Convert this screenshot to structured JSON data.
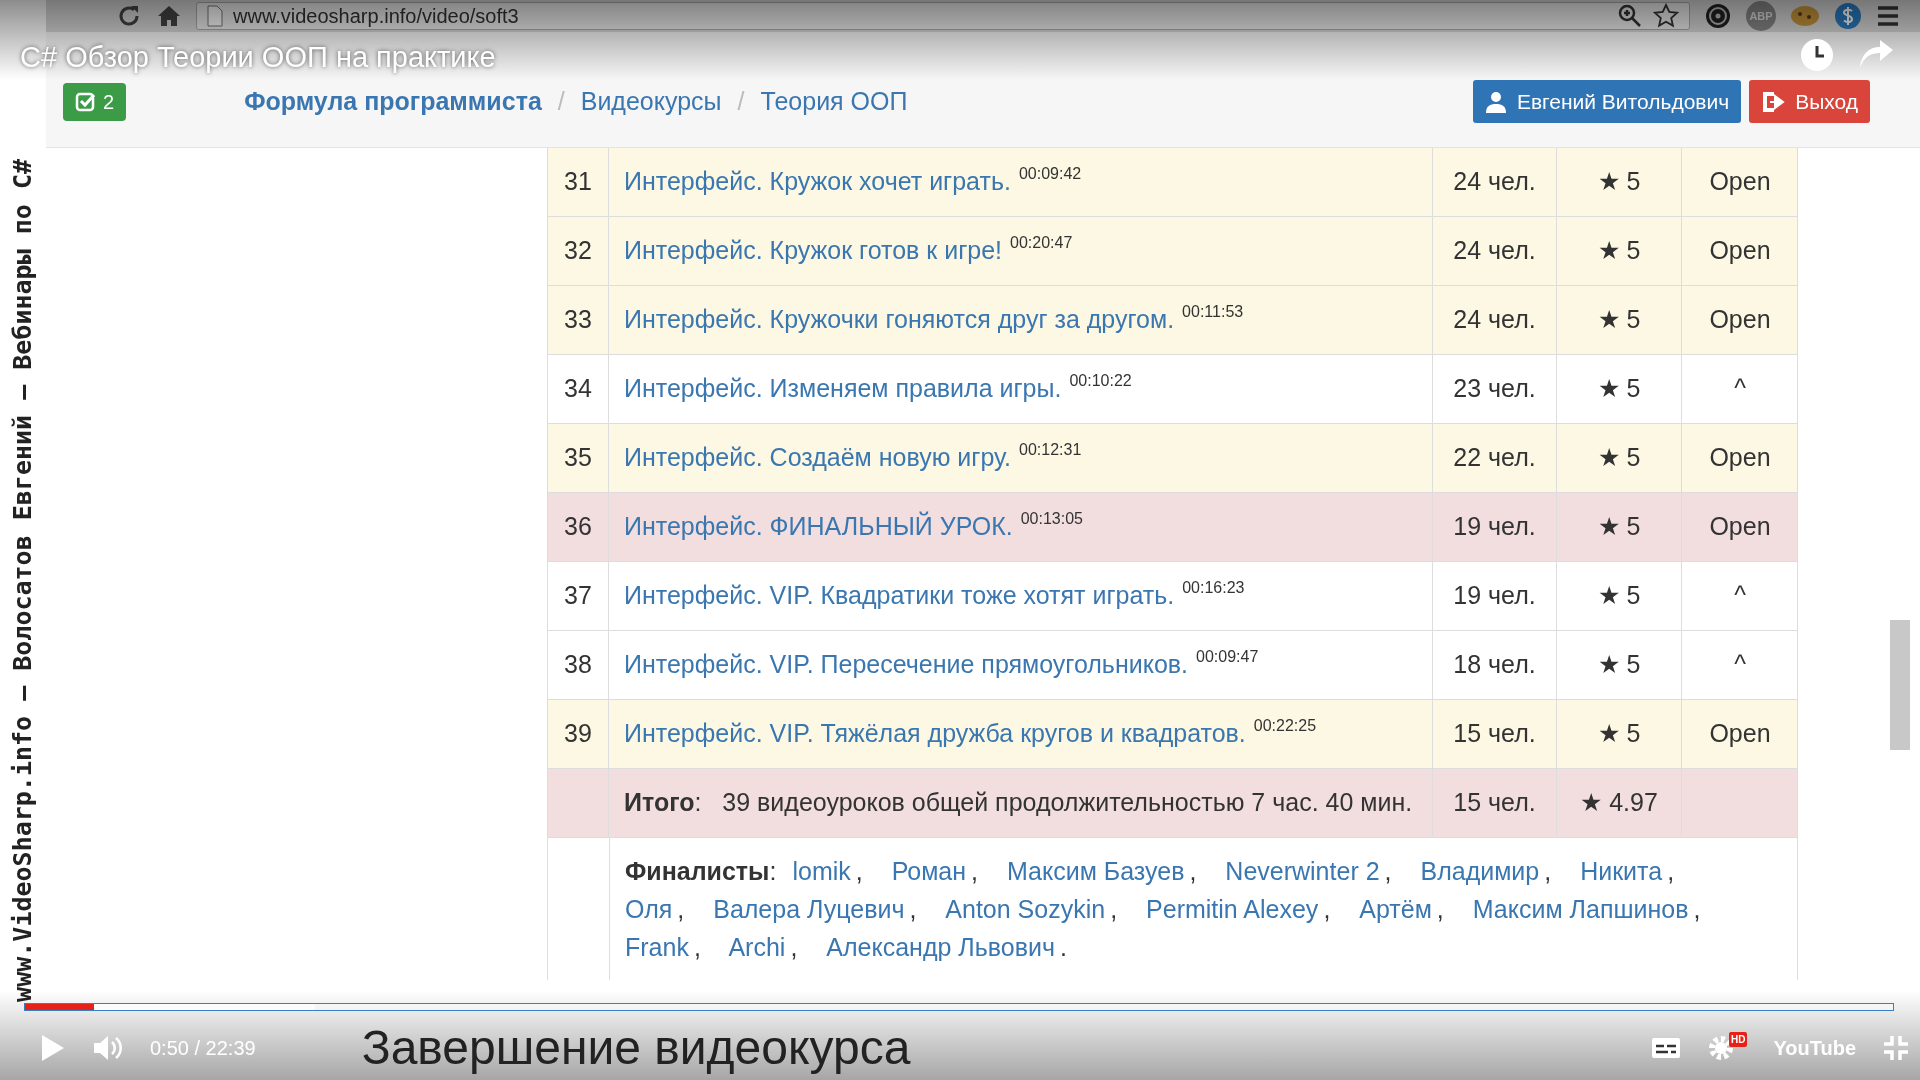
{
  "browser": {
    "url": "www.videosharp.info/video/soft3",
    "abp_label": "ABP"
  },
  "video": {
    "title": "C# Обзор Теории ООП на практике",
    "side_caption": "www.VideoSharp.info — Волосатов Евгений — Вебинары по C#",
    "subtitle": "Завершение видеокурса",
    "time": "0:50 / 22:39",
    "hd_label": "HD",
    "logo": "YouTube"
  },
  "progress": {
    "level": 0.037
  },
  "buffer": {
    "level": 0.155
  },
  "site": {
    "badge": "2",
    "breadcrumb": [
      {
        "label": "Формула программиста",
        "kind": "brand"
      },
      {
        "label": "Видеокурсы",
        "kind": "link"
      },
      {
        "label": "Теория ООП",
        "kind": "link"
      }
    ],
    "separator": "/",
    "user_button": "Евгений Витольдович",
    "logout_button": "Выход"
  },
  "lessons": [
    {
      "number": "31",
      "title": "Интерфейс. Кружок хочет играть.",
      "duration": "00:09:42",
      "viewers": "24 чел.",
      "rating": "★ 5",
      "status": "Open",
      "color": "#fcf8e3"
    },
    {
      "number": "32",
      "title": "Интерфейс. Кружок готов к игре!",
      "duration": "00:20:47",
      "viewers": "24 чел.",
      "rating": "★ 5",
      "status": "Open",
      "color": "#fcf8e3"
    },
    {
      "number": "33",
      "title": "Интерфейс. Кружочки гоняются друг за другом.",
      "duration": "00:11:53",
      "viewers": "24 чел.",
      "rating": "★ 5",
      "status": "Open",
      "color": "#fcf8e3"
    },
    {
      "number": "34",
      "title": "Интерфейс. Изменяем правила игры.",
      "duration": "00:10:22",
      "viewers": "23 чел.",
      "rating": "★ 5",
      "status": "^",
      "color": "#ffffff"
    },
    {
      "number": "35",
      "title": "Интерфейс. Создаём новую игру.",
      "duration": "00:12:31",
      "viewers": "22 чел.",
      "rating": "★ 5",
      "status": "Open",
      "color": "#fcf8e3"
    },
    {
      "number": "36",
      "title": "Интерфейс. ФИНАЛЬНЫЙ УРОК.",
      "duration": "00:13:05",
      "viewers": "19 чел.",
      "rating": "★ 5",
      "status": "Open",
      "color": "#f2dede"
    },
    {
      "number": "37",
      "title": "Интерфейс. VIP. Квадратики тоже хотят играть.",
      "duration": "00:16:23",
      "viewers": "19 чел.",
      "rating": "★ 5",
      "status": "^",
      "color": "#ffffff"
    },
    {
      "number": "38",
      "title": "Интерфейс. VIP. Пересечение прямоугольников.",
      "duration": "00:09:47",
      "viewers": "18 чел.",
      "rating": "★ 5",
      "status": "^",
      "color": "#ffffff"
    },
    {
      "number": "39",
      "title": "Интерфейс. VIP. Тяжёлая дружба кругов и квадратов.",
      "duration": "00:22:25",
      "viewers": "15 чел.",
      "rating": "★ 5",
      "status": "Open",
      "color": "#fcf8e3"
    }
  ],
  "total": {
    "text": "**Итого**:   39 видеоуроков общей продолжительностью 7 час. 40 мин.",
    "viewers": "15 чел.",
    "rating": "★ 4.97"
  },
  "finalists": {
    "label": "**Финалисты**:",
    "separator": ",",
    "terminator": ".",
    "names": [
      "lomik",
      "Роман",
      "Максим Базуев",
      "Neverwinter 2",
      "Владимир",
      "Никита",
      "Оля",
      "Валера Луцевич",
      "Anton Sozykin",
      "Permitin Alexey",
      "Артём",
      "Максим Лапшинов",
      "Frank",
      "Archi",
      "Александр Львович"
    ]
  }
}
